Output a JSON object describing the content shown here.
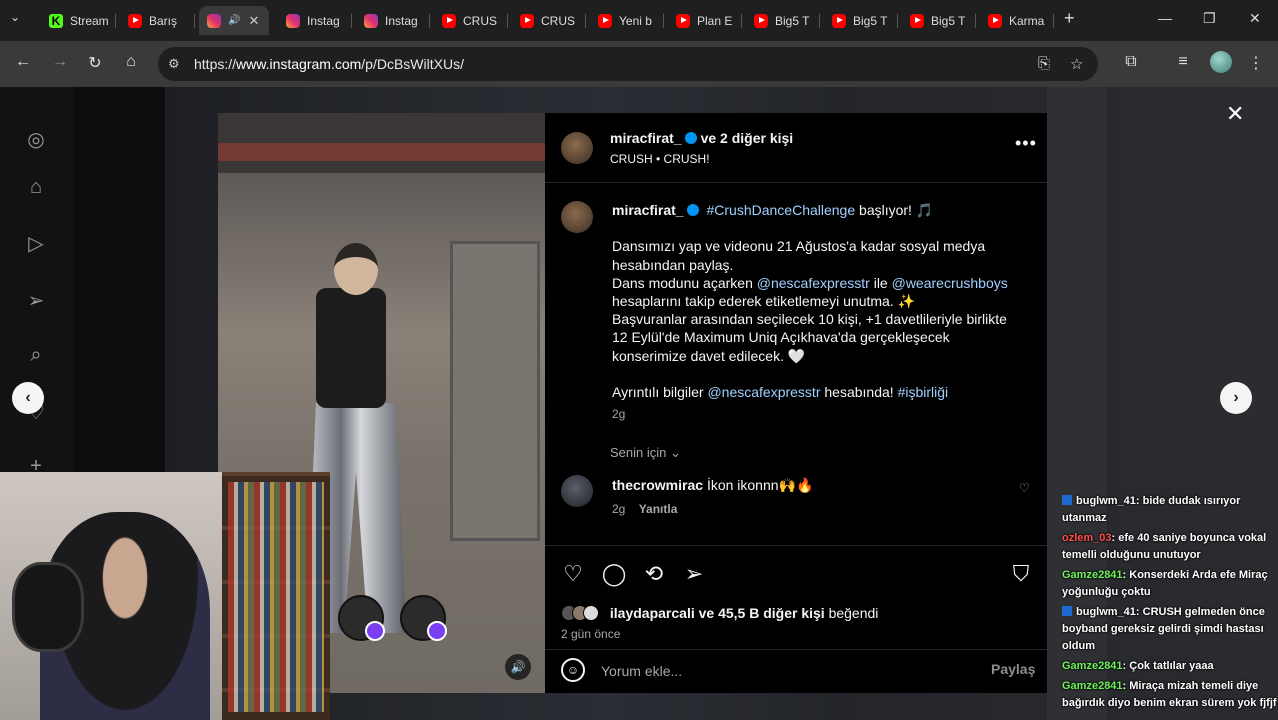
{
  "browser": {
    "tabs": [
      {
        "label": "Stream",
        "icon": "kick-icon",
        "active": false
      },
      {
        "label": "Barış",
        "icon": "youtube-icon",
        "active": false
      },
      {
        "label": "",
        "icon": "instagram-icon",
        "active": true
      },
      {
        "label": "Instag",
        "icon": "instagram-icon",
        "active": false
      },
      {
        "label": "Instag",
        "icon": "instagram-icon",
        "active": false
      },
      {
        "label": "CRUS",
        "icon": "youtube-icon",
        "active": false
      },
      {
        "label": "CRUS",
        "icon": "youtube-icon",
        "active": false
      },
      {
        "label": "Yeni b",
        "icon": "youtube-icon",
        "active": false
      },
      {
        "label": "Plan E",
        "icon": "youtube-icon",
        "active": false
      },
      {
        "label": "Big5 T",
        "icon": "youtube-icon",
        "active": false
      },
      {
        "label": "Big5 T",
        "icon": "youtube-icon",
        "active": false
      },
      {
        "label": "Big5 T",
        "icon": "youtube-icon",
        "active": false
      },
      {
        "label": "Karma",
        "icon": "youtube-icon",
        "active": false
      }
    ],
    "url_prefix": "https://",
    "url_host": "www.instagram.com",
    "url_path": "/p/DcBsWiltXUs/"
  },
  "post": {
    "author": "miracfirat_",
    "collab": "ve 2 diğer kişi",
    "audio": "CRUSH • CRUSH!",
    "caption_author": "miracfirat_",
    "caption_p1_tag": "#CrushDanceChallenge",
    "caption_p1_rest": " başlıyor! 🎵",
    "caption_p2a": "Dansımızı yap ve videonu 21 Ağustos'a kadar sosyal medya hesabından paylaş.",
    "caption_p2b_pre": "Dans modunu açarken ",
    "mention1": "@nescafexpresstr",
    "caption_p2b_mid": " ile ",
    "mention2": "@wearecrushboys",
    "caption_p2b_post": " hesaplarını takip ederek etiketlemeyi unutma. ✨",
    "caption_p2c": "Başvuranlar arasından seçilecek 10 kişi, +1 davetlileriyle birlikte 12 Eylül'de Maximum Uniq Açıkhava'da gerçekleşecek konserimize davet edilecek. 🤍",
    "caption_p3_pre": "Ayrıntılı bilgiler ",
    "mention3": "@nescafexpresstr",
    "caption_p3_mid": " hesabında! ",
    "tag2": "#işbirliği",
    "caption_time": "2g",
    "sort_label": "Senin için",
    "likes_user": "ilaydaparcali",
    "likes_rest": "ve 45,5 B diğer kişi",
    "likes_suffix": "beğendi",
    "posted_ago": "2 gün önce",
    "comment_placeholder": "Yorum ekle...",
    "share_label": "Paylaş"
  },
  "comments": [
    {
      "user": "thecrowmirac",
      "text": "İkon ikonnn🙌🔥",
      "time": "2g",
      "reply": "Yanıtla"
    }
  ],
  "chat": [
    {
      "user": "buglwm_41",
      "color": "#ffffff",
      "badge": true,
      "text": ": bide dudak ısırıyor utanmaz"
    },
    {
      "user": "ozlem_03",
      "color": "#ff4d4d",
      "badge": false,
      "text": ": efe 40 saniye boyunca vokal temelli olduğunu unutuyor"
    },
    {
      "user": "Gamze2841",
      "color": "#6ff25a",
      "badge": false,
      "text": ": Konserdeki Arda efe Miraç yoğunluğu çoktu"
    },
    {
      "user": "buglwm_41",
      "color": "#ffffff",
      "badge": true,
      "text": ": CRUSH gelmeden önce boyband gereksiz gelirdi şimdi hastası oldum"
    },
    {
      "user": "Gamze2841",
      "color": "#6ff25a",
      "badge": false,
      "text": ": Çok tatlılar yaaa"
    },
    {
      "user": "Gamze2841",
      "color": "#6ff25a",
      "badge": false,
      "text": ": Miraça mizah temeli diye bağırdık diyo benim ekran sürem yok fjfjf"
    }
  ]
}
